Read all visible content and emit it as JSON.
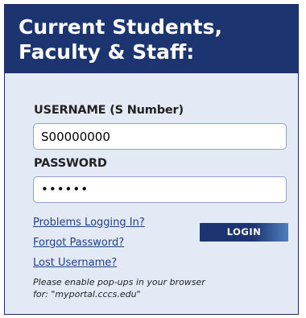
{
  "header": {
    "title_line1": "Current Students,",
    "title_line2": "Faculty & Staff:"
  },
  "form": {
    "username_label": "USERNAME (S Number)",
    "username_value": "S00000000",
    "password_label": "PASSWORD",
    "password_value": "••••••",
    "login_label": "LOGIN"
  },
  "links": {
    "problems": "Problems Logging In?",
    "forgot_password": "Forgot Password?",
    "lost_username": "Lost Username?"
  },
  "note": {
    "line1": "Please enable pop-ups in your browser",
    "line2": "for: \"myportal.cccs.edu\""
  },
  "colors": {
    "header_bg": "#1c3470",
    "panel_bg": "#e3eaf6",
    "link": "#1f3f8c"
  }
}
